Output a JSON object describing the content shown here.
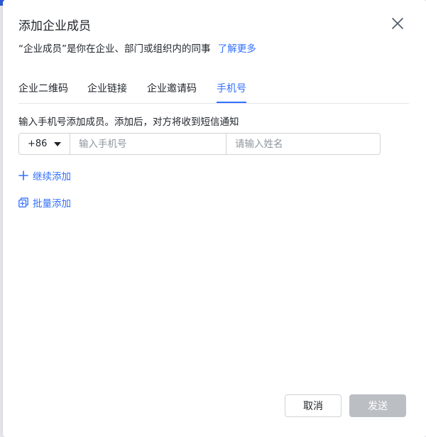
{
  "dialog": {
    "title": "添加企业成员",
    "subtitle": "“企业成员”是你在企业、部门或组织内的同事",
    "learn_more": "了解更多"
  },
  "tabs": [
    {
      "label": "企业二维码",
      "active": false
    },
    {
      "label": "企业链接",
      "active": false
    },
    {
      "label": "企业邀请码",
      "active": false
    },
    {
      "label": "手机号",
      "active": true
    }
  ],
  "form": {
    "hint": "输入手机号添加成员。添加后，对方将收到短信通知",
    "country_code": "+86",
    "phone_placeholder": "输入手机号",
    "phone_value": "",
    "name_placeholder": "请输入姓名",
    "name_value": ""
  },
  "actions": {
    "continue_add": "继续添加",
    "batch_add": "批量添加"
  },
  "footer": {
    "cancel": "取消",
    "send": "发送"
  },
  "colors": {
    "accent": "#3370ff",
    "disabled_button": "#bbbfc4",
    "border": "#d0d3d6"
  },
  "icons": {
    "close": "close-icon",
    "caret": "caret-down-icon",
    "plus": "plus-icon",
    "batch": "batch-add-icon"
  }
}
